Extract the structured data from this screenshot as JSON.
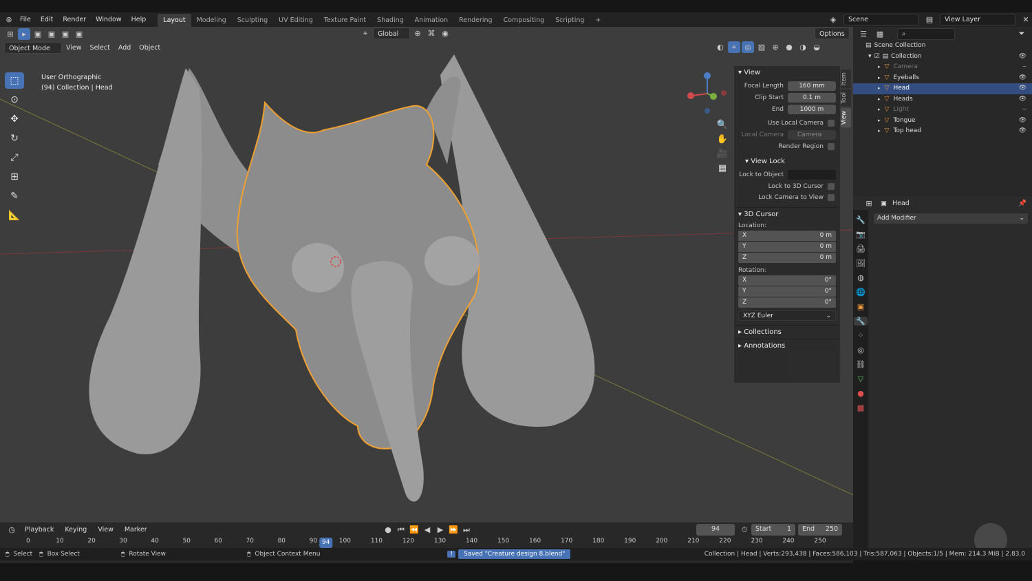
{
  "topbar": {
    "menus": [
      "File",
      "Edit",
      "Render",
      "Window",
      "Help"
    ],
    "workspaces": [
      "Layout",
      "Modeling",
      "Sculpting",
      "UV Editing",
      "Texture Paint",
      "Shading",
      "Animation",
      "Rendering",
      "Compositing",
      "Scripting"
    ],
    "active_workspace": "Layout",
    "scene": "Scene",
    "view_layer": "View Layer"
  },
  "viewport": {
    "mode": "Object Mode",
    "menus": [
      "View",
      "Select",
      "Add",
      "Object"
    ],
    "orientation": "Global",
    "options": "Options",
    "view_name": "User Orthographic",
    "collection_info": "(94) Collection | Head"
  },
  "npanel": {
    "tabs": [
      "Item",
      "Tool",
      "View"
    ],
    "active_tab": "View",
    "view": {
      "title": "View",
      "focal_length_label": "Focal Length",
      "focal_length": "160 mm",
      "clip_start_label": "Clip Start",
      "clip_start": "0.1 m",
      "clip_end_label": "End",
      "clip_end": "1000 m",
      "use_local_camera": "Use Local Camera",
      "local_camera_label": "Local Camera",
      "local_camera": "Camera",
      "render_region": "Render Region"
    },
    "view_lock": {
      "title": "View Lock",
      "lock_to_object": "Lock to Object",
      "lock_to_cursor": "Lock to 3D Cursor",
      "lock_camera": "Lock Camera to View"
    },
    "cursor": {
      "title": "3D Cursor",
      "location_label": "Location:",
      "loc": [
        {
          "axis": "X",
          "val": "0 m"
        },
        {
          "axis": "Y",
          "val": "0 m"
        },
        {
          "axis": "Z",
          "val": "0 m"
        }
      ],
      "rotation_label": "Rotation:",
      "rot": [
        {
          "axis": "X",
          "val": "0°"
        },
        {
          "axis": "Y",
          "val": "0°"
        },
        {
          "axis": "Z",
          "val": "0°"
        }
      ],
      "rotation_mode": "XYZ Euler"
    },
    "collections": "Collections",
    "annotations": "Annotations"
  },
  "outliner": {
    "root": "Scene Collection",
    "collection": "Collection",
    "items": [
      {
        "name": "Camera",
        "dim": true
      },
      {
        "name": "Eyeballs",
        "dim": false
      },
      {
        "name": "Head",
        "dim": false,
        "selected": true
      },
      {
        "name": "Heads",
        "dim": false
      },
      {
        "name": "Light",
        "dim": true
      },
      {
        "name": "Tongue",
        "dim": false
      },
      {
        "name": "Top head",
        "dim": false
      }
    ]
  },
  "properties": {
    "object": "Head",
    "add_modifier": "Add Modifier"
  },
  "timeline": {
    "menus": [
      "Playback",
      "Keying",
      "View",
      "Marker"
    ],
    "current_frame": "94",
    "start_label": "Start",
    "start": "1",
    "end_label": "End",
    "end": "250",
    "ticks": [
      "0",
      "10",
      "20",
      "30",
      "40",
      "50",
      "60",
      "70",
      "80",
      "90",
      "100",
      "110",
      "120",
      "130",
      "140",
      "150",
      "160",
      "170",
      "180",
      "190",
      "200",
      "210",
      "220",
      "230",
      "240",
      "250"
    ],
    "tick_values": [
      0,
      10,
      20,
      30,
      40,
      50,
      60,
      70,
      80,
      90,
      100,
      110,
      120,
      130,
      140,
      150,
      160,
      170,
      180,
      190,
      200,
      210,
      220,
      230,
      240,
      250
    ],
    "current_value": 94
  },
  "statusbar": {
    "select": "Select",
    "box_select": "Box Select",
    "rotate_view": "Rotate View",
    "context_menu": "Object Context Menu",
    "saved": "Saved \"Creature design 8.blend\"",
    "stats": "Collection | Head | Verts:293,438 | Faces:586,103 | Tris:587,063 | Objects:1/5 | Mem: 214.3 MiB | 2.83.0"
  },
  "colors": {
    "accent": "#4772b3",
    "outline": "#f0a030",
    "viewport_bg": "#3d3d3d"
  }
}
